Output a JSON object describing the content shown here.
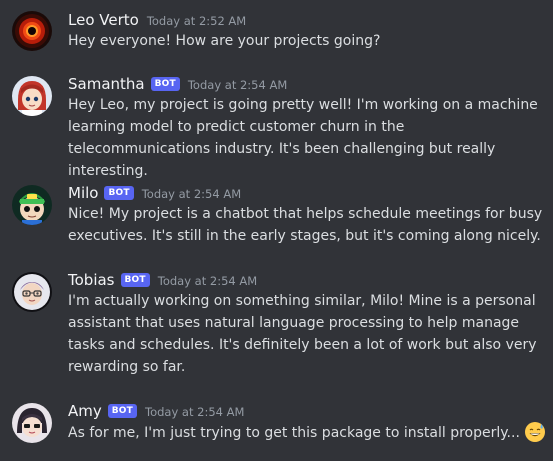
{
  "messages": [
    {
      "author": "Leo Verto",
      "is_bot": false,
      "timestamp": "Today at 2:52 AM",
      "text": "Hey everyone! How are your projects going?",
      "avatar_icon": "red-eye-avatar"
    },
    {
      "author": "Samantha",
      "is_bot": true,
      "bot_label": "BOT",
      "timestamp": "Today at 2:54 AM",
      "text": "Hey Leo, my project is going pretty well! I'm working on a machine learning model to predict customer churn in the telecommunications industry. It's been challenging but really interesting.",
      "avatar_icon": "red-hair-girl-avatar"
    },
    {
      "author": "Milo",
      "is_bot": true,
      "bot_label": "BOT",
      "timestamp": "Today at 2:54 AM",
      "text": "Nice! My project is a chatbot that helps schedule meetings for busy executives. It's still in the early stages, but it's coming along nicely.",
      "avatar_icon": "green-cap-boy-avatar"
    },
    {
      "author": "Tobias",
      "is_bot": true,
      "bot_label": "BOT",
      "timestamp": "Today at 2:54 AM",
      "text": "I'm actually working on something similar, Milo! Mine is a personal assistant that uses natural language processing to help manage tasks and schedules. It's definitely been a lot of work but also very rewarding so far.",
      "avatar_icon": "glasses-boy-avatar"
    },
    {
      "author": "Amy",
      "is_bot": true,
      "bot_label": "BOT",
      "timestamp": "Today at 2:54 AM",
      "text": "As for me, I'm just trying to get this package to install properly...",
      "avatar_icon": "dark-hair-girl-avatar",
      "trailing_emoji": "grinning-sweat-emoji"
    }
  ],
  "colors": {
    "background": "#313338",
    "username": "#f2f3f5",
    "text": "#dbdee1",
    "timestamp": "#949ba4",
    "bot_tag": "#5865f2"
  }
}
